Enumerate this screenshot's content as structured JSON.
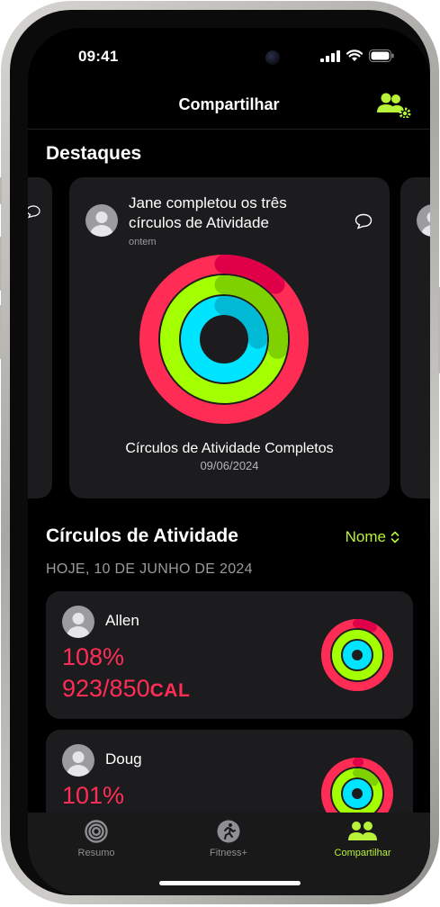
{
  "status": {
    "time": "09:41"
  },
  "nav": {
    "title": "Compartilhar",
    "settings_icon": "sharing-settings-icon"
  },
  "highlights": {
    "section_title": "Destaques",
    "card": {
      "text": "Jane completou os três círculos de Atividade",
      "when": "ontem",
      "caption": "Círculos de Atividade Completos",
      "date": "09/06/2024"
    }
  },
  "activity": {
    "section_title": "Círculos de Atividade",
    "sort_label": "Nome",
    "date_header": "HOJE, 10 DE JUNHO DE 2024",
    "friends": [
      {
        "name": "Allen",
        "percent": "108%",
        "calories": "923/850",
        "unit": "CAL",
        "move_ring": 1.08
      },
      {
        "name": "Doug",
        "percent": "101%",
        "move_ring": 1.01
      }
    ]
  },
  "colors": {
    "move": "#ff2d55",
    "exercise": "#a4ff00",
    "stand": "#00e5ff",
    "accent": "#b8f33a"
  },
  "tabs": [
    {
      "label": "Resumo",
      "icon": "rings-icon",
      "active": false
    },
    {
      "label": "Fitness+",
      "icon": "fitness-plus-icon",
      "active": false
    },
    {
      "label": "Compartilhar",
      "icon": "people-icon",
      "active": true
    }
  ]
}
